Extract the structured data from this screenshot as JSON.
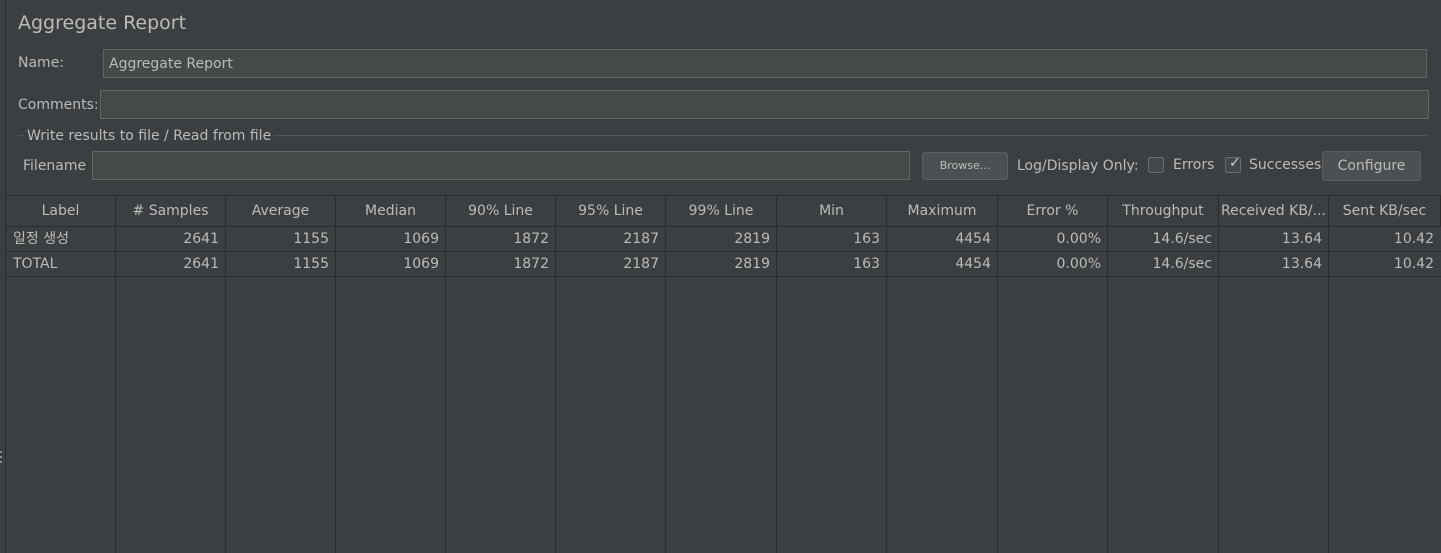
{
  "panel": {
    "title": "Aggregate Report"
  },
  "name": {
    "label": "Name:",
    "value": "Aggregate Report"
  },
  "comments": {
    "label": "Comments:",
    "value": ""
  },
  "file_group": {
    "title": "Write results to file / Read from file",
    "filename_label": "Filename",
    "filename_value": "",
    "browse_label": "Browse...",
    "log_display_label": "Log/Display Only:",
    "errors": {
      "label": "Errors",
      "checked": false
    },
    "successes": {
      "label": "Successes",
      "checked": true
    },
    "configure_label": "Configure"
  },
  "table": {
    "headers": [
      "Label",
      "# Samples",
      "Average",
      "Median",
      "90% Line",
      "95% Line",
      "99% Line",
      "Min",
      "Maximum",
      "Error %",
      "Throughput",
      "Received KB/...",
      "Sent KB/sec"
    ],
    "rows": [
      [
        "일정 생성",
        "2641",
        "1155",
        "1069",
        "1872",
        "2187",
        "2819",
        "163",
        "4454",
        "0.00%",
        "14.6/sec",
        "13.64",
        "10.42"
      ],
      [
        "TOTAL",
        "2641",
        "1155",
        "1069",
        "1872",
        "2187",
        "2819",
        "163",
        "4454",
        "0.00%",
        "14.6/sec",
        "13.64",
        "10.42"
      ]
    ]
  },
  "colors": {
    "background": "#3c3f41",
    "grid": "#2b2b2b",
    "text": "#bbbbbb",
    "field": "#45494a"
  }
}
